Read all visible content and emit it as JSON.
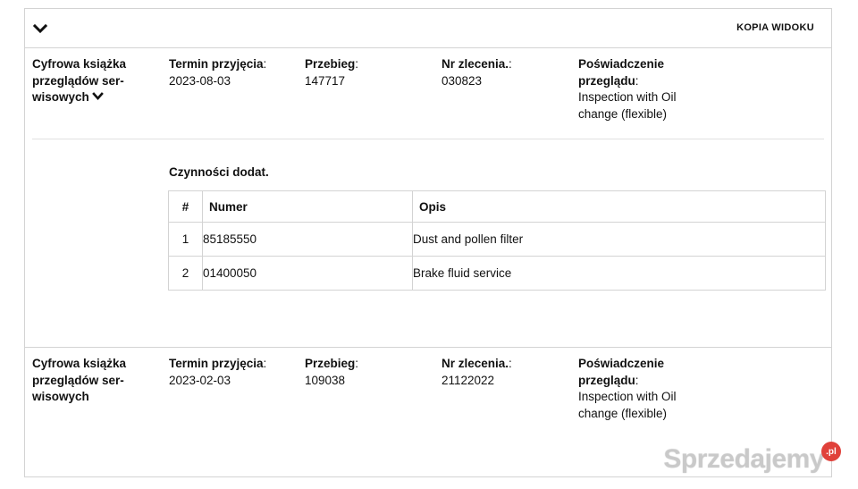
{
  "header": {
    "toggle_icon": "chevron-down-icon",
    "copy_view_label": "KOPIA WIDOKU"
  },
  "entries": [
    {
      "book_label": "Cyfrowa książka przeglądów ser-wisowych",
      "book_line1": "Cyfrowa książka",
      "book_line2": "przeglądów ser-",
      "book_line3": "wisowych",
      "expanded": true,
      "date_label": "Termin przyjęcia",
      "date_value": "2023-08-03",
      "mileage_label": "Przebieg",
      "mileage_value": "147717",
      "order_label": "Nr zlecenia.",
      "order_value": "030823",
      "cert_label_line1": "Poświadczenie",
      "cert_label_line2": "przeglądu",
      "cert_value_line1": "Inspection with Oil",
      "cert_value_line2": "change (flexible)",
      "extra": {
        "title": "Czynności dodat.",
        "columns": [
          "#",
          "Numer",
          "Opis"
        ],
        "rows": [
          {
            "n": "1",
            "numer": "85185550",
            "opis": "Dust and pollen filter"
          },
          {
            "n": "2",
            "numer": "01400050",
            "opis": "Brake fluid service"
          }
        ]
      }
    },
    {
      "book_line1": "Cyfrowa książka",
      "book_line2": "przeglądów ser-",
      "book_line3": "wisowych",
      "expanded": false,
      "date_label": "Termin przyjęcia",
      "date_value": "2023-02-03",
      "mileage_label": "Przebieg",
      "mileage_value": "109038",
      "order_label": "Nr zlecenia.",
      "order_value": "21122022",
      "cert_label_line1": "Poświadczenie",
      "cert_label_line2": "przeglądu",
      "cert_value_line1": "Inspection with Oil",
      "cert_value_line2": "change (flexible)"
    }
  ],
  "watermark": {
    "text": "Sprzedajemy",
    "badge": ".pl"
  }
}
